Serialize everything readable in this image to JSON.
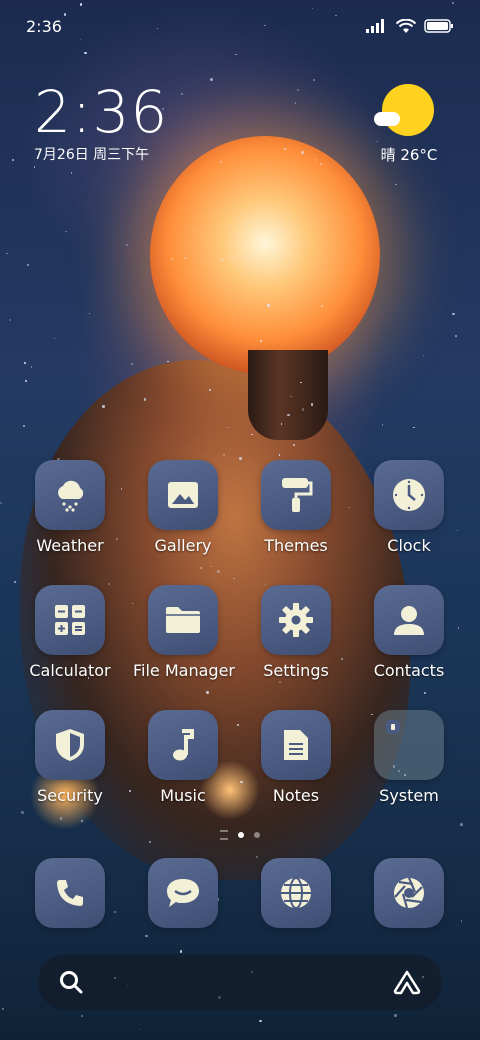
{
  "status_bar": {
    "time": "2:36"
  },
  "clock_widget": {
    "time": "2:36",
    "date": "7月26日 周三下午"
  },
  "weather_widget": {
    "text": "晴 26°C"
  },
  "apps": [
    {
      "label": "Weather",
      "icon": "weather-icon"
    },
    {
      "label": "Gallery",
      "icon": "gallery-icon"
    },
    {
      "label": "Themes",
      "icon": "themes-icon"
    },
    {
      "label": "Clock",
      "icon": "clock-icon"
    },
    {
      "label": "Calculator",
      "icon": "calculator-icon"
    },
    {
      "label": "File Manager",
      "icon": "folder-icon"
    },
    {
      "label": "Settings",
      "icon": "gear-icon"
    },
    {
      "label": "Contacts",
      "icon": "contacts-icon"
    },
    {
      "label": "Security",
      "icon": "shield-icon"
    },
    {
      "label": "Music",
      "icon": "music-icon"
    },
    {
      "label": "Notes",
      "icon": "notes-icon"
    },
    {
      "label": "System",
      "icon": "system-folder-icon"
    }
  ],
  "dock": [
    {
      "icon": "phone-icon"
    },
    {
      "icon": "messages-icon"
    },
    {
      "icon": "browser-icon"
    },
    {
      "icon": "camera-icon"
    }
  ],
  "colors": {
    "icon_bg": "#4a5a80",
    "icon_fg": "#f3f0d8",
    "sun": "#ffd21f"
  }
}
